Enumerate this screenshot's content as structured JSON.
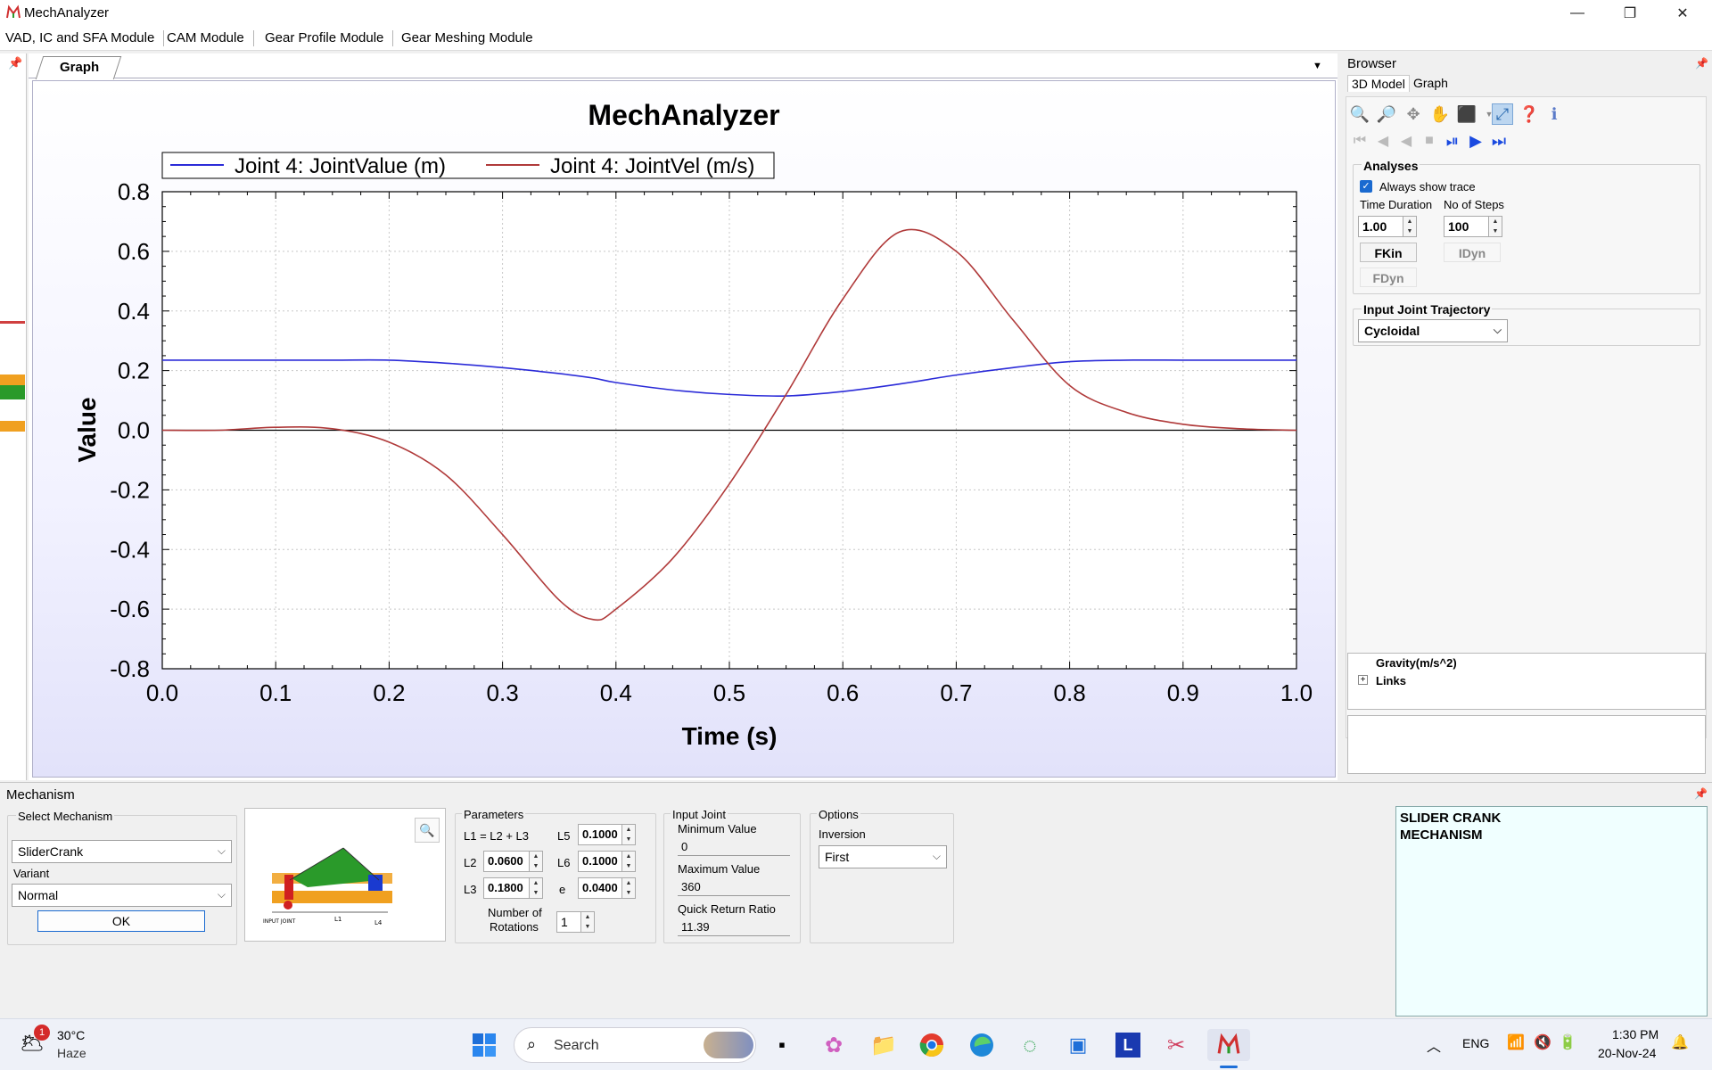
{
  "window": {
    "title": "MechAnalyzer",
    "min": "—",
    "restore": "❐",
    "close": "✕"
  },
  "menu": [
    "VAD, IC and SFA Module",
    "CAM Module",
    "Gear Profile Module",
    "Gear Meshing Module"
  ],
  "doc_tab": {
    "label": "Graph"
  },
  "chart_data": {
    "type": "line",
    "title": "MechAnalyzer",
    "xlabel": "Time (s)",
    "ylabel": "Value",
    "xlim": [
      0.0,
      1.0
    ],
    "ylim": [
      -0.8,
      0.8
    ],
    "x_ticks": [
      "0.0",
      "0.1",
      "0.2",
      "0.3",
      "0.4",
      "0.5",
      "0.6",
      "0.7",
      "0.8",
      "0.9",
      "1.0"
    ],
    "y_ticks": [
      "0.8",
      "0.6",
      "0.4",
      "0.2",
      "0.0",
      "-0.2",
      "-0.4",
      "-0.6",
      "-0.8"
    ],
    "grid": true,
    "legend_position": "top-left",
    "x": [
      0.0,
      0.05,
      0.1,
      0.15,
      0.2,
      0.25,
      0.3,
      0.35,
      0.38,
      0.4,
      0.45,
      0.5,
      0.55,
      0.6,
      0.65,
      0.7,
      0.75,
      0.8,
      0.85,
      0.9,
      0.95,
      1.0
    ],
    "series": [
      {
        "name": "Joint 4: JointValue (m)",
        "color": "#2b2bd8",
        "values": [
          0.235,
          0.235,
          0.235,
          0.235,
          0.235,
          0.225,
          0.21,
          0.19,
          0.175,
          0.16,
          0.135,
          0.12,
          0.115,
          0.13,
          0.155,
          0.185,
          0.21,
          0.23,
          0.235,
          0.235,
          0.235,
          0.235
        ]
      },
      {
        "name": "Joint 4: JointVel (m/s)",
        "color": "#b03a3a",
        "values": [
          0.0,
          0.0,
          0.01,
          0.005,
          -0.04,
          -0.15,
          -0.35,
          -0.57,
          -0.635,
          -0.6,
          -0.43,
          -0.18,
          0.12,
          0.44,
          0.665,
          0.6,
          0.37,
          0.15,
          0.06,
          0.02,
          0.005,
          0.0
        ]
      }
    ]
  },
  "browser": {
    "title": "Browser",
    "tabs": [
      "3D Model",
      "Graph"
    ],
    "analyses": {
      "heading": "Analyses",
      "always_show_trace": "Always show trace",
      "always_show_trace_checked": true,
      "time_duration_label": "Time Duration",
      "time_duration": "1.00",
      "steps_label": "No of Steps",
      "steps": "100",
      "fkin": "FKin",
      "idyn": "IDyn",
      "fdyn": "FDyn"
    },
    "trajectory": {
      "heading": "Input Joint Trajectory",
      "value": "Cycloidal"
    },
    "tree": [
      "Gravity(m/s^2)",
      "Links"
    ]
  },
  "mechanism": {
    "title": "Mechanism",
    "select_label": "Select Mechanism",
    "select_value": "SliderCrank",
    "variant_label": "Variant",
    "variant_value": "Normal",
    "ok": "OK",
    "params_heading": "Parameters",
    "formula": "L1 = L2 + L3",
    "L2_label": "L2",
    "L2": "0.0600",
    "L3_label": "L3",
    "L3": "0.1800",
    "L5_label": "L5",
    "L5": "0.1000",
    "L6_label": "L6",
    "L6": "0.1000",
    "e_label": "e",
    "e": "0.0400",
    "rotations_label_1": "Number of",
    "rotations_label_2": "Rotations",
    "rotations": "1",
    "input_joint_heading": "Input Joint",
    "min_label": "Minimum Value",
    "min": "0",
    "max_label": "Maximum Value",
    "max": "360",
    "qrr_label": "Quick Return Ratio",
    "qrr": "11.39",
    "options_heading": "Options",
    "inversion_label": "Inversion",
    "inversion_value": "First",
    "description_1": "SLIDER CRANK",
    "description_2": "MECHANISM",
    "diagram_labels": {
      "input_joint": "INPUT JOINT",
      "l1": "L1",
      "l4": "L4"
    }
  },
  "taskbar": {
    "weather_temp": "30°C",
    "weather_desc": "Haze",
    "weather_badge": "1",
    "search": "Search",
    "lang": "ENG",
    "time": "1:30 PM",
    "date": "20-Nov-24",
    "l_app": "L"
  }
}
